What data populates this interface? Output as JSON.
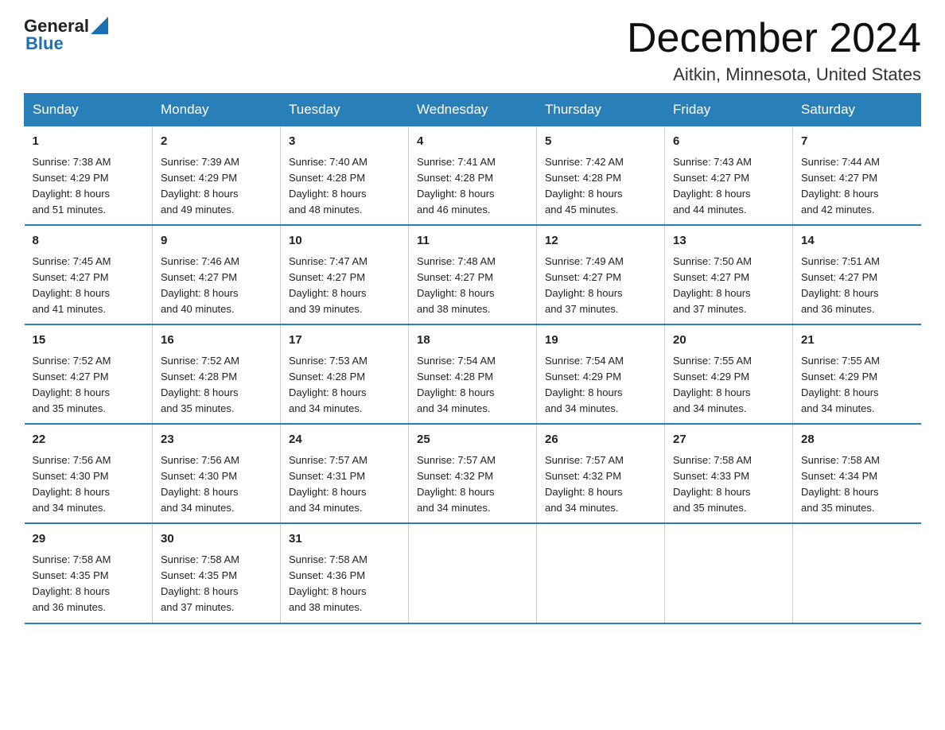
{
  "header": {
    "logo_general": "General",
    "logo_blue": "Blue",
    "month_title": "December 2024",
    "location": "Aitkin, Minnesota, United States"
  },
  "days_of_week": [
    "Sunday",
    "Monday",
    "Tuesday",
    "Wednesday",
    "Thursday",
    "Friday",
    "Saturday"
  ],
  "weeks": [
    [
      {
        "day": "1",
        "sunrise": "7:38 AM",
        "sunset": "4:29 PM",
        "daylight": "8 hours and 51 minutes."
      },
      {
        "day": "2",
        "sunrise": "7:39 AM",
        "sunset": "4:29 PM",
        "daylight": "8 hours and 49 minutes."
      },
      {
        "day": "3",
        "sunrise": "7:40 AM",
        "sunset": "4:28 PM",
        "daylight": "8 hours and 48 minutes."
      },
      {
        "day": "4",
        "sunrise": "7:41 AM",
        "sunset": "4:28 PM",
        "daylight": "8 hours and 46 minutes."
      },
      {
        "day": "5",
        "sunrise": "7:42 AM",
        "sunset": "4:28 PM",
        "daylight": "8 hours and 45 minutes."
      },
      {
        "day": "6",
        "sunrise": "7:43 AM",
        "sunset": "4:27 PM",
        "daylight": "8 hours and 44 minutes."
      },
      {
        "day": "7",
        "sunrise": "7:44 AM",
        "sunset": "4:27 PM",
        "daylight": "8 hours and 42 minutes."
      }
    ],
    [
      {
        "day": "8",
        "sunrise": "7:45 AM",
        "sunset": "4:27 PM",
        "daylight": "8 hours and 41 minutes."
      },
      {
        "day": "9",
        "sunrise": "7:46 AM",
        "sunset": "4:27 PM",
        "daylight": "8 hours and 40 minutes."
      },
      {
        "day": "10",
        "sunrise": "7:47 AM",
        "sunset": "4:27 PM",
        "daylight": "8 hours and 39 minutes."
      },
      {
        "day": "11",
        "sunrise": "7:48 AM",
        "sunset": "4:27 PM",
        "daylight": "8 hours and 38 minutes."
      },
      {
        "day": "12",
        "sunrise": "7:49 AM",
        "sunset": "4:27 PM",
        "daylight": "8 hours and 37 minutes."
      },
      {
        "day": "13",
        "sunrise": "7:50 AM",
        "sunset": "4:27 PM",
        "daylight": "8 hours and 37 minutes."
      },
      {
        "day": "14",
        "sunrise": "7:51 AM",
        "sunset": "4:27 PM",
        "daylight": "8 hours and 36 minutes."
      }
    ],
    [
      {
        "day": "15",
        "sunrise": "7:52 AM",
        "sunset": "4:27 PM",
        "daylight": "8 hours and 35 minutes."
      },
      {
        "day": "16",
        "sunrise": "7:52 AM",
        "sunset": "4:28 PM",
        "daylight": "8 hours and 35 minutes."
      },
      {
        "day": "17",
        "sunrise": "7:53 AM",
        "sunset": "4:28 PM",
        "daylight": "8 hours and 34 minutes."
      },
      {
        "day": "18",
        "sunrise": "7:54 AM",
        "sunset": "4:28 PM",
        "daylight": "8 hours and 34 minutes."
      },
      {
        "day": "19",
        "sunrise": "7:54 AM",
        "sunset": "4:29 PM",
        "daylight": "8 hours and 34 minutes."
      },
      {
        "day": "20",
        "sunrise": "7:55 AM",
        "sunset": "4:29 PM",
        "daylight": "8 hours and 34 minutes."
      },
      {
        "day": "21",
        "sunrise": "7:55 AM",
        "sunset": "4:29 PM",
        "daylight": "8 hours and 34 minutes."
      }
    ],
    [
      {
        "day": "22",
        "sunrise": "7:56 AM",
        "sunset": "4:30 PM",
        "daylight": "8 hours and 34 minutes."
      },
      {
        "day": "23",
        "sunrise": "7:56 AM",
        "sunset": "4:30 PM",
        "daylight": "8 hours and 34 minutes."
      },
      {
        "day": "24",
        "sunrise": "7:57 AM",
        "sunset": "4:31 PM",
        "daylight": "8 hours and 34 minutes."
      },
      {
        "day": "25",
        "sunrise": "7:57 AM",
        "sunset": "4:32 PM",
        "daylight": "8 hours and 34 minutes."
      },
      {
        "day": "26",
        "sunrise": "7:57 AM",
        "sunset": "4:32 PM",
        "daylight": "8 hours and 34 minutes."
      },
      {
        "day": "27",
        "sunrise": "7:58 AM",
        "sunset": "4:33 PM",
        "daylight": "8 hours and 35 minutes."
      },
      {
        "day": "28",
        "sunrise": "7:58 AM",
        "sunset": "4:34 PM",
        "daylight": "8 hours and 35 minutes."
      }
    ],
    [
      {
        "day": "29",
        "sunrise": "7:58 AM",
        "sunset": "4:35 PM",
        "daylight": "8 hours and 36 minutes."
      },
      {
        "day": "30",
        "sunrise": "7:58 AM",
        "sunset": "4:35 PM",
        "daylight": "8 hours and 37 minutes."
      },
      {
        "day": "31",
        "sunrise": "7:58 AM",
        "sunset": "4:36 PM",
        "daylight": "8 hours and 38 minutes."
      },
      null,
      null,
      null,
      null
    ]
  ],
  "labels": {
    "sunrise": "Sunrise:",
    "sunset": "Sunset:",
    "daylight": "Daylight:"
  }
}
